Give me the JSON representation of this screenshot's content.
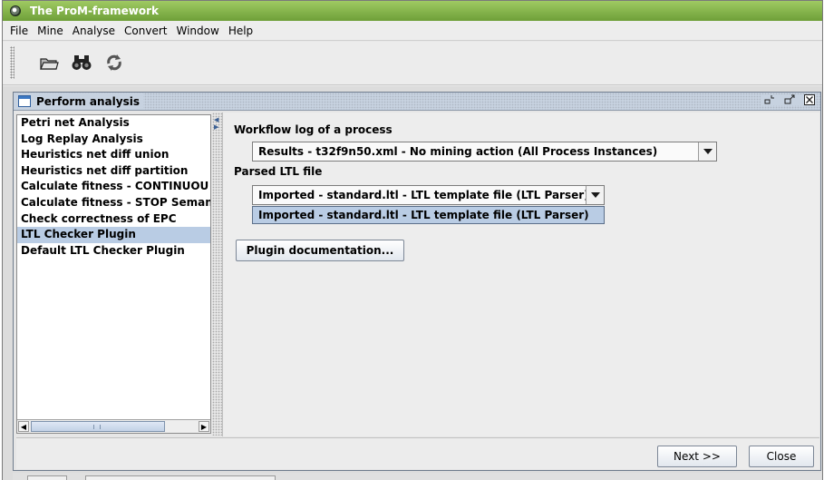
{
  "window": {
    "title": "The ProM-framework"
  },
  "menubar": {
    "items": [
      "File",
      "Mine",
      "Analyse",
      "Convert",
      "Window",
      "Help"
    ]
  },
  "toolbar": {
    "buttons": [
      "folder-open-icon",
      "binoculars-icon",
      "refresh-icon"
    ]
  },
  "frame": {
    "title": "Perform analysis"
  },
  "plugins": {
    "items": [
      "Petri net Analysis",
      "Log Replay Analysis",
      "Heuristics net diff union",
      "Heuristics net diff partition",
      "Calculate fitness - CONTINUOU",
      "Calculate fitness - STOP Seman",
      "Check correctness of EPC",
      "LTL Checker Plugin",
      "Default LTL Checker Plugin"
    ],
    "selected_index": 7
  },
  "settings": {
    "log_label": "Workflow log of a process",
    "log_value": "Results - t32f9n50.xml - No mining action (All Process Instances)",
    "ltl_label": "Parsed LTL file",
    "ltl_value": "Imported - standard.ltl - LTL template file (LTL Parser)",
    "ltl_dropdown_option": "Imported - standard.ltl - LTL template file (LTL Parser)",
    "doc_button": "Plugin documentation..."
  },
  "footer": {
    "next_button": "Next >>",
    "close_button": "Close"
  },
  "colors": {
    "titlebar": "#7fb046",
    "selection": "#b9cce4",
    "frame_title": "#c7d2e0"
  }
}
